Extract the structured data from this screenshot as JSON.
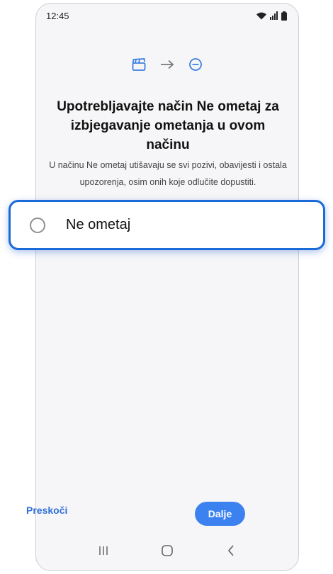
{
  "status_bar": {
    "time": "12:45",
    "icons": [
      "wifi-icon",
      "signal-icon",
      "battery-icon"
    ]
  },
  "flow_icons": [
    "clapperboard-icon",
    "arrow-right-icon",
    "do-not-disturb-icon"
  ],
  "title": "Upotrebljavajte način Ne ometaj za izbjegavanje ometanja u ovom načinu",
  "description": "U načinu Ne ometaj utišavaju se svi pozivi, obavijesti i ostala upozorenja, osim onih koje odlučite dopustiti.",
  "option": {
    "label": "Ne ometaj",
    "selected": false
  },
  "footer": {
    "skip_label": "Preskoči",
    "next_label": "Dalje"
  },
  "nav": [
    "recent-apps-icon",
    "home-icon",
    "back-icon"
  ],
  "colors": {
    "accent": "#3b82f0",
    "highlight_border": "#1a6ad8",
    "link": "#2f6fd6",
    "background": "#f6f6f8"
  }
}
